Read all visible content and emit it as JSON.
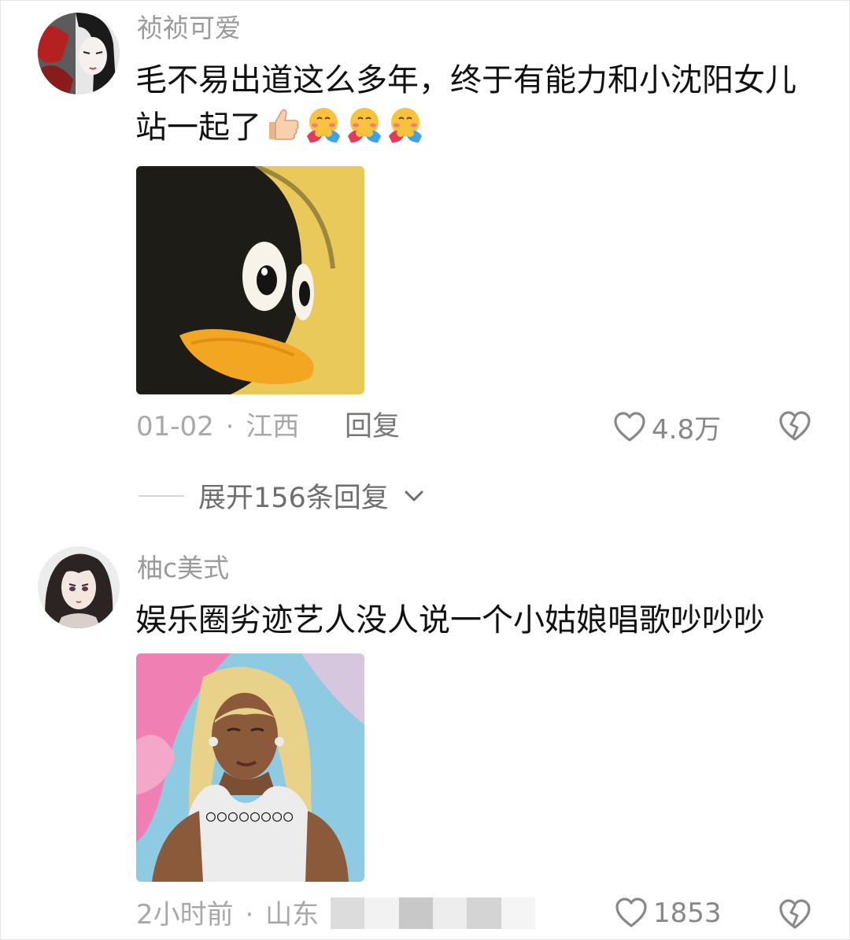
{
  "comments": [
    {
      "username": "祯祯可爱",
      "text": "毛不易出道这么多年，终于有能力和小沈阳女儿站一起了",
      "emojis": [
        "thumbs-up-icon",
        "hugging-face-icon",
        "hugging-face-icon",
        "hugging-face-icon"
      ],
      "date": "01-02",
      "separator": "·",
      "location": "江西",
      "reply_label": "回复",
      "likes": "4.8万",
      "expand_label": "展开156条回复"
    },
    {
      "username": "柚c美式",
      "text": "娱乐圈劣迹艺人没人说一个小姑娘唱歌吵吵吵",
      "image_caption": "○○○○○○○○",
      "date": "2小时前",
      "separator": "·",
      "location": "山东",
      "likes": "1853"
    }
  ],
  "colors": {
    "text": "#111111",
    "muted": "#9a9a9a",
    "penguin_yellow": "#e8c95a",
    "beak_orange": "#f3a622"
  }
}
